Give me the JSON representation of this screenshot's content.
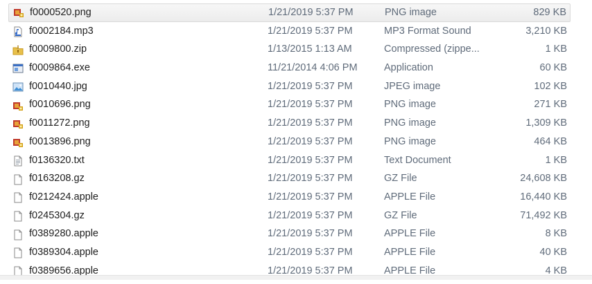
{
  "files": [
    {
      "name": "f0000520.png",
      "date": "1/21/2019 5:37 PM",
      "type": "PNG image",
      "size": "829 KB",
      "icon": "png-image-icon",
      "selected": true
    },
    {
      "name": "f0002184.mp3",
      "date": "1/21/2019 5:37 PM",
      "type": "MP3 Format Sound",
      "size": "3,210 KB",
      "icon": "mp3-audio-icon"
    },
    {
      "name": "f0009800.zip",
      "date": "1/13/2015 1:13 AM",
      "type": "Compressed (zippe...",
      "size": "1 KB",
      "icon": "zip-folder-icon"
    },
    {
      "name": "f0009864.exe",
      "date": "11/21/2014 4:06 PM",
      "type": "Application",
      "size": "60 KB",
      "icon": "application-icon"
    },
    {
      "name": "f0010440.jpg",
      "date": "1/21/2019 5:37 PM",
      "type": "JPEG image",
      "size": "102 KB",
      "icon": "jpeg-image-icon"
    },
    {
      "name": "f0010696.png",
      "date": "1/21/2019 5:37 PM",
      "type": "PNG image",
      "size": "271 KB",
      "icon": "png-image-icon"
    },
    {
      "name": "f0011272.png",
      "date": "1/21/2019 5:37 PM",
      "type": "PNG image",
      "size": "1,309 KB",
      "icon": "png-image-icon"
    },
    {
      "name": "f0013896.png",
      "date": "1/21/2019 5:37 PM",
      "type": "PNG image",
      "size": "464 KB",
      "icon": "png-image-icon"
    },
    {
      "name": "f0136320.txt",
      "date": "1/21/2019 5:37 PM",
      "type": "Text Document",
      "size": "1 KB",
      "icon": "text-document-icon"
    },
    {
      "name": "f0163208.gz",
      "date": "1/21/2019 5:37 PM",
      "type": "GZ File",
      "size": "24,608 KB",
      "icon": "generic-file-icon"
    },
    {
      "name": "f0212424.apple",
      "date": "1/21/2019 5:37 PM",
      "type": "APPLE File",
      "size": "16,440 KB",
      "icon": "generic-file-icon"
    },
    {
      "name": "f0245304.gz",
      "date": "1/21/2019 5:37 PM",
      "type": "GZ File",
      "size": "71,492 KB",
      "icon": "generic-file-icon"
    },
    {
      "name": "f0389280.apple",
      "date": "1/21/2019 5:37 PM",
      "type": "APPLE File",
      "size": "8 KB",
      "icon": "generic-file-icon"
    },
    {
      "name": "f0389304.apple",
      "date": "1/21/2019 5:37 PM",
      "type": "APPLE File",
      "size": "40 KB",
      "icon": "generic-file-icon"
    },
    {
      "name": "f0389656.apple",
      "date": "1/21/2019 5:37 PM",
      "type": "APPLE File",
      "size": "4 KB",
      "icon": "generic-file-icon"
    }
  ],
  "colors": {
    "selection_bg": "#ececec",
    "secondary_text": "#5f6b7a",
    "primary_text": "#1e1e1e"
  }
}
